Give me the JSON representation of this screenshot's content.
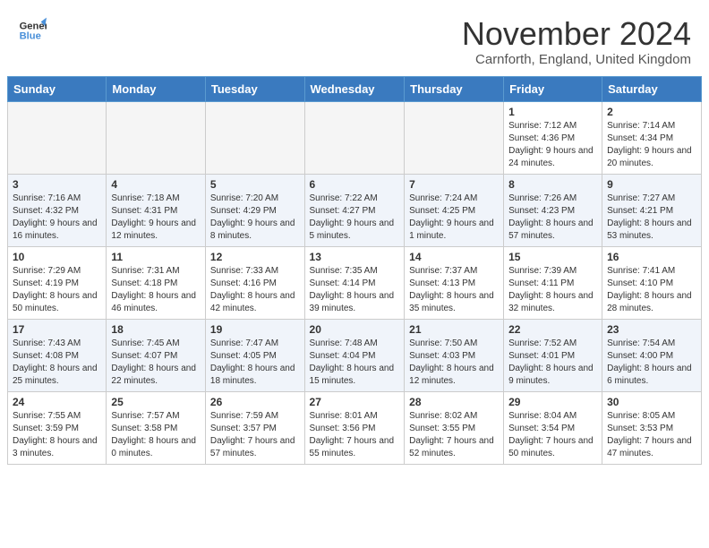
{
  "logo": {
    "line1": "General",
    "line2": "Blue"
  },
  "title": "November 2024",
  "location": "Carnforth, England, United Kingdom",
  "days_of_week": [
    "Sunday",
    "Monday",
    "Tuesday",
    "Wednesday",
    "Thursday",
    "Friday",
    "Saturday"
  ],
  "weeks": [
    [
      {
        "day": "",
        "info": ""
      },
      {
        "day": "",
        "info": ""
      },
      {
        "day": "",
        "info": ""
      },
      {
        "day": "",
        "info": ""
      },
      {
        "day": "",
        "info": ""
      },
      {
        "day": "1",
        "info": "Sunrise: 7:12 AM\nSunset: 4:36 PM\nDaylight: 9 hours and 24 minutes."
      },
      {
        "day": "2",
        "info": "Sunrise: 7:14 AM\nSunset: 4:34 PM\nDaylight: 9 hours and 20 minutes."
      }
    ],
    [
      {
        "day": "3",
        "info": "Sunrise: 7:16 AM\nSunset: 4:32 PM\nDaylight: 9 hours and 16 minutes."
      },
      {
        "day": "4",
        "info": "Sunrise: 7:18 AM\nSunset: 4:31 PM\nDaylight: 9 hours and 12 minutes."
      },
      {
        "day": "5",
        "info": "Sunrise: 7:20 AM\nSunset: 4:29 PM\nDaylight: 9 hours and 8 minutes."
      },
      {
        "day": "6",
        "info": "Sunrise: 7:22 AM\nSunset: 4:27 PM\nDaylight: 9 hours and 5 minutes."
      },
      {
        "day": "7",
        "info": "Sunrise: 7:24 AM\nSunset: 4:25 PM\nDaylight: 9 hours and 1 minute."
      },
      {
        "day": "8",
        "info": "Sunrise: 7:26 AM\nSunset: 4:23 PM\nDaylight: 8 hours and 57 minutes."
      },
      {
        "day": "9",
        "info": "Sunrise: 7:27 AM\nSunset: 4:21 PM\nDaylight: 8 hours and 53 minutes."
      }
    ],
    [
      {
        "day": "10",
        "info": "Sunrise: 7:29 AM\nSunset: 4:19 PM\nDaylight: 8 hours and 50 minutes."
      },
      {
        "day": "11",
        "info": "Sunrise: 7:31 AM\nSunset: 4:18 PM\nDaylight: 8 hours and 46 minutes."
      },
      {
        "day": "12",
        "info": "Sunrise: 7:33 AM\nSunset: 4:16 PM\nDaylight: 8 hours and 42 minutes."
      },
      {
        "day": "13",
        "info": "Sunrise: 7:35 AM\nSunset: 4:14 PM\nDaylight: 8 hours and 39 minutes."
      },
      {
        "day": "14",
        "info": "Sunrise: 7:37 AM\nSunset: 4:13 PM\nDaylight: 8 hours and 35 minutes."
      },
      {
        "day": "15",
        "info": "Sunrise: 7:39 AM\nSunset: 4:11 PM\nDaylight: 8 hours and 32 minutes."
      },
      {
        "day": "16",
        "info": "Sunrise: 7:41 AM\nSunset: 4:10 PM\nDaylight: 8 hours and 28 minutes."
      }
    ],
    [
      {
        "day": "17",
        "info": "Sunrise: 7:43 AM\nSunset: 4:08 PM\nDaylight: 8 hours and 25 minutes."
      },
      {
        "day": "18",
        "info": "Sunrise: 7:45 AM\nSunset: 4:07 PM\nDaylight: 8 hours and 22 minutes."
      },
      {
        "day": "19",
        "info": "Sunrise: 7:47 AM\nSunset: 4:05 PM\nDaylight: 8 hours and 18 minutes."
      },
      {
        "day": "20",
        "info": "Sunrise: 7:48 AM\nSunset: 4:04 PM\nDaylight: 8 hours and 15 minutes."
      },
      {
        "day": "21",
        "info": "Sunrise: 7:50 AM\nSunset: 4:03 PM\nDaylight: 8 hours and 12 minutes."
      },
      {
        "day": "22",
        "info": "Sunrise: 7:52 AM\nSunset: 4:01 PM\nDaylight: 8 hours and 9 minutes."
      },
      {
        "day": "23",
        "info": "Sunrise: 7:54 AM\nSunset: 4:00 PM\nDaylight: 8 hours and 6 minutes."
      }
    ],
    [
      {
        "day": "24",
        "info": "Sunrise: 7:55 AM\nSunset: 3:59 PM\nDaylight: 8 hours and 3 minutes."
      },
      {
        "day": "25",
        "info": "Sunrise: 7:57 AM\nSunset: 3:58 PM\nDaylight: 8 hours and 0 minutes."
      },
      {
        "day": "26",
        "info": "Sunrise: 7:59 AM\nSunset: 3:57 PM\nDaylight: 7 hours and 57 minutes."
      },
      {
        "day": "27",
        "info": "Sunrise: 8:01 AM\nSunset: 3:56 PM\nDaylight: 7 hours and 55 minutes."
      },
      {
        "day": "28",
        "info": "Sunrise: 8:02 AM\nSunset: 3:55 PM\nDaylight: 7 hours and 52 minutes."
      },
      {
        "day": "29",
        "info": "Sunrise: 8:04 AM\nSunset: 3:54 PM\nDaylight: 7 hours and 50 minutes."
      },
      {
        "day": "30",
        "info": "Sunrise: 8:05 AM\nSunset: 3:53 PM\nDaylight: 7 hours and 47 minutes."
      }
    ]
  ]
}
